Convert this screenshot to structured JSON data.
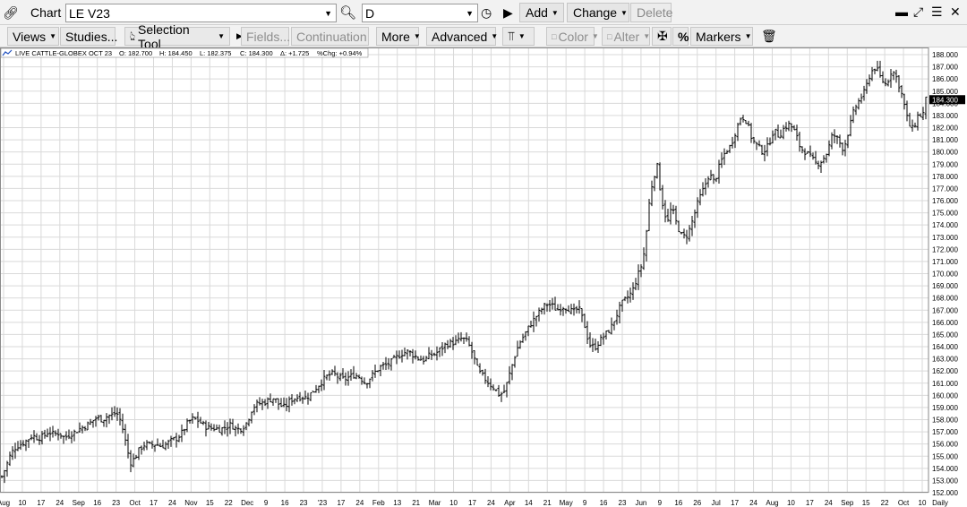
{
  "window": {
    "title": "Chart",
    "symbol_value": "LE V23",
    "period_value": "D",
    "add_label": "Add",
    "change_label": "Change",
    "delete_label": "Delete",
    "controls": [
      "minimize",
      "restore",
      "menu",
      "close"
    ]
  },
  "toolbar": {
    "views_label": "Views",
    "studies_label": "Studies...",
    "selection_tool_label": "Selection Tool",
    "fields_label": "Fields...",
    "continuation_label": "Continuation",
    "more_label": "More",
    "advanced_label": "Advanced",
    "color_label": "Color",
    "alter_label": "Alter",
    "percent_label": "%",
    "markers_label": "Markers"
  },
  "quote_bar": {
    "name": "LIVE CATTLE-GLOBEX OCT 23",
    "open": "O: 182.700",
    "high": "H: 184.450",
    "low": "L: 182.375",
    "close": "C: 184.300",
    "change": "Δ: +1.725",
    "pct_change": "%Chg: +0.94%"
  },
  "chart_data": {
    "type": "ohlc",
    "title": "",
    "ylim": [
      152,
      188.5
    ],
    "y_ticks": [
      "152.000",
      "153.000",
      "154.000",
      "155.000",
      "156.000",
      "157.000",
      "158.000",
      "159.000",
      "160.000",
      "161.000",
      "162.000",
      "163.000",
      "164.000",
      "165.000",
      "166.000",
      "167.000",
      "168.000",
      "169.000",
      "170.000",
      "171.000",
      "172.000",
      "173.000",
      "174.000",
      "175.000",
      "176.000",
      "177.000",
      "178.000",
      "179.000",
      "180.000",
      "181.000",
      "182.000",
      "183.000",
      "184.000",
      "185.000",
      "186.000",
      "187.000",
      "188.000"
    ],
    "x_tick_labels": [
      "Aug",
      "10",
      "17",
      "24",
      "Sep",
      "16",
      "23",
      "Oct",
      "17",
      "24",
      "Nov",
      "15",
      "22",
      "Dec",
      "9",
      "16",
      "23",
      "'23",
      "17",
      "24",
      "Feb",
      "13",
      "21",
      "Mar",
      "10",
      "17",
      "24",
      "Apr",
      "14",
      "21",
      "May",
      "9",
      "16",
      "23",
      "Jun",
      "9",
      "16",
      "26",
      "Jul",
      "17",
      "24",
      "Aug",
      "10",
      "17",
      "24",
      "Sep",
      "15",
      "22",
      "Oct",
      "10"
    ],
    "period_label": "Daily",
    "last_price_label": "184.300",
    "grid": true,
    "close_path": [
      [
        0,
        153.0
      ],
      [
        6,
        154.0
      ],
      [
        12,
        155.2
      ],
      [
        18,
        155.8
      ],
      [
        24,
        156.0
      ],
      [
        30,
        156.3
      ],
      [
        36,
        156.7
      ],
      [
        42,
        156.5
      ],
      [
        48,
        156.6
      ],
      [
        54,
        157.0
      ],
      [
        60,
        156.8
      ],
      [
        66,
        156.9
      ],
      [
        72,
        156.5
      ],
      [
        78,
        156.8
      ],
      [
        84,
        157.0
      ],
      [
        90,
        157.3
      ],
      [
        96,
        157.5
      ],
      [
        102,
        157.8
      ],
      [
        108,
        158.2
      ],
      [
        114,
        158.0
      ],
      [
        120,
        158.3
      ],
      [
        126,
        158.4
      ],
      [
        130,
        158.6
      ],
      [
        134,
        158.0
      ],
      [
        138,
        157.0
      ],
      [
        142,
        155.5
      ],
      [
        146,
        154.5
      ],
      [
        150,
        154.8
      ],
      [
        156,
        155.6
      ],
      [
        162,
        156.0
      ],
      [
        168,
        155.9
      ],
      [
        174,
        156.0
      ],
      [
        180,
        155.8
      ],
      [
        186,
        156.0
      ],
      [
        192,
        156.3
      ],
      [
        198,
        156.5
      ],
      [
        204,
        157.0
      ],
      [
        210,
        157.8
      ],
      [
        216,
        158.1
      ],
      [
        222,
        157.9
      ],
      [
        228,
        157.5
      ],
      [
        234,
        157.3
      ],
      [
        240,
        157.3
      ],
      [
        246,
        157.2
      ],
      [
        252,
        157.4
      ],
      [
        258,
        157.6
      ],
      [
        264,
        157.2
      ],
      [
        270,
        157.3
      ],
      [
        276,
        157.8
      ],
      [
        282,
        159.0
      ],
      [
        288,
        159.3
      ],
      [
        294,
        159.4
      ],
      [
        300,
        159.6
      ],
      [
        306,
        159.8
      ],
      [
        312,
        159.2
      ],
      [
        318,
        159.0
      ],
      [
        324,
        159.6
      ],
      [
        330,
        159.8
      ],
      [
        336,
        159.9
      ],
      [
        342,
        159.8
      ],
      [
        348,
        160.2
      ],
      [
        354,
        160.7
      ],
      [
        360,
        161.2
      ],
      [
        366,
        161.6
      ],
      [
        372,
        161.8
      ],
      [
        378,
        161.5
      ],
      [
        384,
        161.3
      ],
      [
        390,
        161.5
      ],
      [
        396,
        161.7
      ],
      [
        402,
        161.5
      ],
      [
        408,
        161.0
      ],
      [
        414,
        161.5
      ],
      [
        420,
        162.0
      ],
      [
        426,
        162.4
      ],
      [
        432,
        162.5
      ],
      [
        438,
        162.8
      ],
      [
        444,
        163.2
      ],
      [
        450,
        163.5
      ],
      [
        456,
        163.6
      ],
      [
        462,
        163.3
      ],
      [
        468,
        163.0
      ],
      [
        474,
        162.9
      ],
      [
        480,
        163.3
      ],
      [
        486,
        163.4
      ],
      [
        492,
        163.8
      ],
      [
        498,
        164.2
      ],
      [
        504,
        164.3
      ],
      [
        510,
        164.4
      ],
      [
        516,
        164.7
      ],
      [
        522,
        164.4
      ],
      [
        528,
        163.4
      ],
      [
        534,
        162.0
      ],
      [
        540,
        161.5
      ],
      [
        546,
        161.0
      ],
      [
        552,
        160.6
      ],
      [
        558,
        160.0
      ],
      [
        564,
        160.4
      ],
      [
        568,
        161.5
      ],
      [
        572,
        162.5
      ],
      [
        576,
        163.5
      ],
      [
        580,
        164.3
      ],
      [
        586,
        165.0
      ],
      [
        592,
        165.8
      ],
      [
        598,
        166.4
      ],
      [
        604,
        167.0
      ],
      [
        610,
        167.5
      ],
      [
        616,
        167.4
      ],
      [
        622,
        167.0
      ],
      [
        628,
        167.3
      ],
      [
        634,
        167.2
      ],
      [
        640,
        166.8
      ],
      [
        646,
        167.2
      ],
      [
        652,
        166.0
      ],
      [
        658,
        164.2
      ],
      [
        664,
        163.9
      ],
      [
        670,
        164.5
      ],
      [
        676,
        165.0
      ],
      [
        682,
        165.5
      ],
      [
        688,
        166.5
      ],
      [
        694,
        167.5
      ],
      [
        700,
        168.0
      ],
      [
        706,
        168.5
      ],
      [
        712,
        169.8
      ],
      [
        718,
        171.0
      ],
      [
        722,
        173.5
      ],
      [
        726,
        176.5
      ],
      [
        730,
        178.0
      ],
      [
        734,
        178.8
      ],
      [
        738,
        176.5
      ],
      [
        742,
        175.0
      ],
      [
        746,
        174.3
      ],
      [
        750,
        175.5
      ],
      [
        756,
        174.0
      ],
      [
        762,
        173.0
      ],
      [
        768,
        173.2
      ],
      [
        774,
        174.5
      ],
      [
        780,
        176.0
      ],
      [
        786,
        177.0
      ],
      [
        792,
        178.2
      ],
      [
        798,
        177.5
      ],
      [
        804,
        179.0
      ],
      [
        810,
        180.0
      ],
      [
        816,
        180.5
      ],
      [
        822,
        181.8
      ],
      [
        828,
        183.0
      ],
      [
        834,
        182.5
      ],
      [
        840,
        181.0
      ],
      [
        846,
        180.5
      ],
      [
        852,
        180.0
      ],
      [
        858,
        180.5
      ],
      [
        864,
        181.8
      ],
      [
        870,
        181.3
      ],
      [
        876,
        182.0
      ],
      [
        882,
        182.3
      ],
      [
        888,
        181.6
      ],
      [
        894,
        180.3
      ],
      [
        900,
        180.0
      ],
      [
        906,
        179.5
      ],
      [
        912,
        179.0
      ],
      [
        918,
        179.3
      ],
      [
        924,
        180.0
      ],
      [
        930,
        181.5
      ],
      [
        936,
        181.0
      ],
      [
        942,
        180.2
      ],
      [
        948,
        181.8
      ],
      [
        954,
        183.5
      ],
      [
        960,
        184.3
      ],
      [
        966,
        185.0
      ],
      [
        972,
        186.5
      ],
      [
        978,
        187.0
      ],
      [
        984,
        186.0
      ],
      [
        990,
        185.5
      ],
      [
        996,
        186.8
      ],
      [
        1002,
        186.0
      ],
      [
        1008,
        184.5
      ],
      [
        1014,
        182.5
      ],
      [
        1018,
        181.8
      ],
      [
        1022,
        182.3
      ],
      [
        1026,
        183.2
      ],
      [
        1030,
        182.8
      ],
      [
        1034,
        184.3
      ]
    ]
  }
}
